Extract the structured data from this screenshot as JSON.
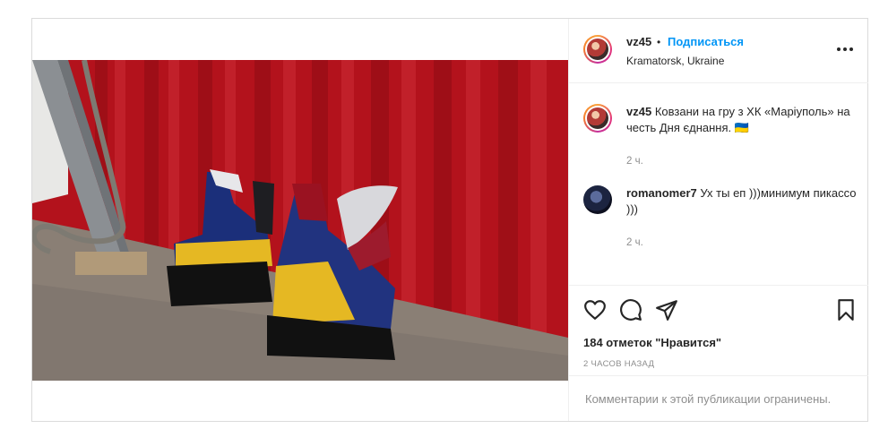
{
  "post": {
    "username": "vz45",
    "follow_label": "Подписаться",
    "location": "Kramatorsk, Ukraine",
    "caption_user": "vz45",
    "caption_text": "Ковзани на гру з ХК «Маріуполь» на честь Дня єднання. 🇺🇦",
    "caption_time": "2 ч.",
    "comments": [
      {
        "user": "romanomer7",
        "text": "Ух ты еп )))минимум пикассо )))",
        "time": "2 ч."
      }
    ],
    "likes_label": "184 отметок \"Нравится\"",
    "time_ago": "2 ЧАСОВ НАЗАД",
    "comments_restricted": "Комментарии к этой публикации ограничены.",
    "icons": [
      "more-options-icon",
      "heart-icon",
      "comment-icon",
      "share-icon",
      "bookmark-icon"
    ]
  },
  "colors": {
    "follow_blue": "#0095f6",
    "muted": "#8e8e8e",
    "border": "#dbdbdb"
  }
}
